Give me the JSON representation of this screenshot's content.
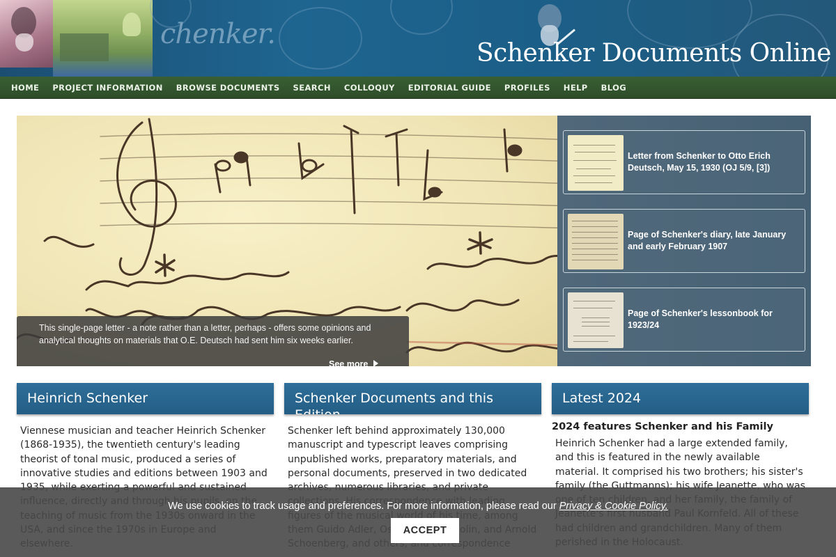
{
  "header": {
    "title": "Schenker Documents Online",
    "script_word": "chenker."
  },
  "nav": {
    "items": [
      "HOME",
      "PROJECT INFORMATION",
      "BROWSE DOCUMENTS",
      "SEARCH",
      "COLLOQUY",
      "EDITORIAL GUIDE",
      "PROFILES",
      "HELP",
      "BLOG"
    ]
  },
  "hero": {
    "caption": "This single-page letter - a note rather than a letter, perhaps - offers some opinions and analytical thoughts on materials that O.E. Deutsch had sent him six weeks earlier.",
    "see_more": "See more",
    "slides": [
      {
        "label": "Letter from Schenker to Otto Erich Deutsch, May 15, 1930 (OJ 5/9, [3])"
      },
      {
        "label": "Page of Schenker's diary, late January and early February 1907"
      },
      {
        "label": "Page of Schenker's lessonbook for 1923/24"
      }
    ]
  },
  "columns": {
    "schenker": {
      "heading": "Heinrich Schenker",
      "body": "Viennese musician and teacher Heinrich Schenker (1868-1935), the twentieth century's leading theorist of tonal music, produced a series of innovative studies and editions between 1903 and 1935, while exerting a powerful and sustained influence, directly and through his pupils, on the teaching of music from the 1930s onward in the USA, and since the 1970s in Europe and elsewhere."
    },
    "documents": {
      "heading": "Schenker Documents and this Edition",
      "body": "Schenker left behind approximately 130,000 manuscript and typescript leaves comprising unpublished works, preparatory materials, and personal documents, preserved in two dedicated archives, numerous libraries, and private collections. His correspondence with leading figures of the musical world of his time, among them Guido Adler, Oswald Jonas, Violin, and Arnold Schoenberg, and others, and correspondence"
    },
    "latest": {
      "heading": "Latest 2024",
      "subheading": "2024 features Schenker and his Family",
      "body": "Heinrich Schenker had a large extended family, and this is featured in the newly available material. It comprised his two brothers; his sister's family (the Guttmanns); his wife Jeanette, who was one of ten children, and her family, the family of Jeanette's first husband Paul Kornfeld. All of these had children and grandchildren. Many of them perished in the Holocaust."
    }
  },
  "cookie": {
    "text": "We use cookies to track usage and preferences. For more information, please read our",
    "link": "Privacy & Cookie Policy.",
    "accept": "ACCEPT"
  }
}
